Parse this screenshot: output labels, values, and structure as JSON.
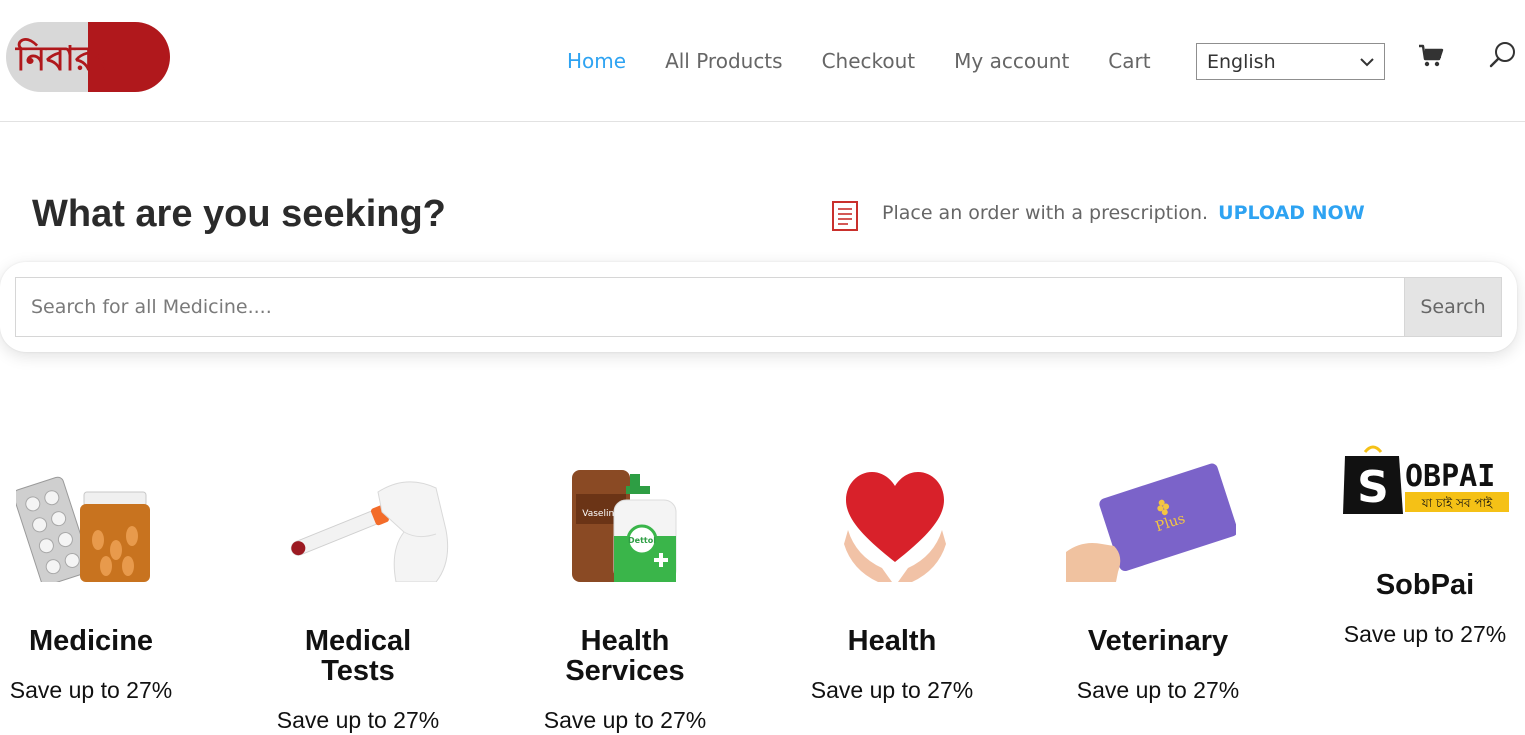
{
  "header": {
    "logo_text": "নিবারক+",
    "nav": [
      {
        "label": "Home",
        "active": true
      },
      {
        "label": "All Products",
        "active": false
      },
      {
        "label": "Checkout",
        "active": false
      },
      {
        "label": "My account",
        "active": false
      },
      {
        "label": "Cart",
        "active": false
      }
    ],
    "language": {
      "selected": "English"
    },
    "icons": [
      "cart-icon",
      "search-icon"
    ],
    "accent_color": "#2ea3f2"
  },
  "seeking": {
    "title": "What are you seeking?",
    "prescription_text": "Place an order with a prescription.",
    "upload_label": "UPLOAD NOW"
  },
  "search": {
    "placeholder": "Search for all Medicine....",
    "button_label": "Search"
  },
  "categories": [
    {
      "name": "Medicine",
      "save": "Save up to 27%",
      "icon": "medicine-pills-image"
    },
    {
      "name": "Medical Tests",
      "save": "Save up to 27%",
      "icon": "test-tube-image"
    },
    {
      "name": "Health Services",
      "save": "Save up to 27%",
      "icon": "vaseline-dettol-image"
    },
    {
      "name": "Health",
      "save": "Save up to 27%",
      "icon": "heart-in-hands-image"
    },
    {
      "name": "Veterinary",
      "save": "Save up to 27%",
      "icon": "plus-card-image"
    },
    {
      "name": "SobPai",
      "save": "Save up to 27%",
      "icon": "sobpai-logo",
      "logo_text": "OBPAI",
      "logo_tagline": "যা চাই সব পাই"
    }
  ],
  "cat_name_lines": {
    "medical_tests": [
      "Medical",
      "Tests"
    ],
    "health_services": [
      "Health",
      "Services"
    ]
  }
}
